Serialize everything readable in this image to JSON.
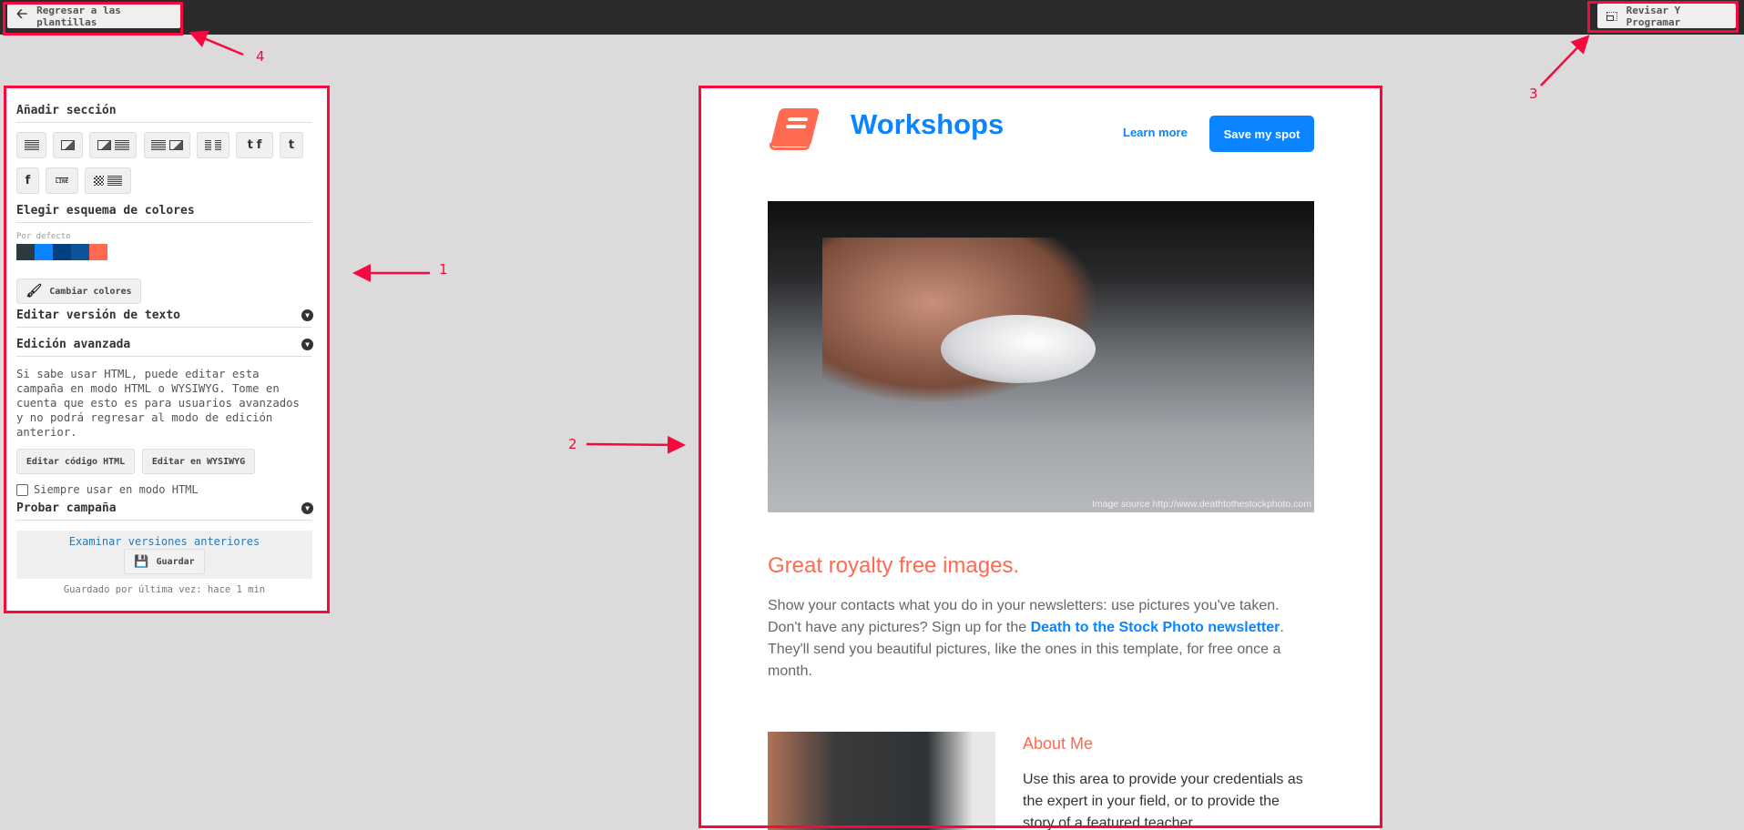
{
  "topbar": {
    "back_label": "Regresar a las plantillas",
    "review_label": "Revisar Y Programar"
  },
  "sidebar": {
    "add_section_title": "Añadir sección",
    "section_blocks": [
      "text",
      "image",
      "image-text",
      "text-image",
      "two-columns",
      "twitter-facebook",
      "twitter",
      "facebook",
      "line",
      "qr-text"
    ],
    "line_label": "LINE",
    "color_scheme_title": "Elegir esquema de colores",
    "scheme_name": "Por defecto",
    "scheme_colors": [
      "#2d3a42",
      "#0a84ff",
      "#02407f",
      "#0b5497",
      "#ff6a50"
    ],
    "change_colors_label": "Cambiar colores",
    "text_version_title": "Editar versión de texto",
    "advanced_title": "Edición avanzada",
    "advanced_text": "Si sabe usar HTML, puede editar esta campaña en modo HTML o WYSIWYG. Tome en cuenta que esto es para usuarios avanzados y no podrá regresar al modo de edición anterior.",
    "edit_html_label": "Editar código HTML",
    "edit_wysiwyg_label": "Editar en WYSIWYG",
    "always_html_label": "Siempre usar en modo HTML",
    "always_html_checked": false,
    "test_title": "Probar campaña",
    "versions_link": "Examinar versiones anteriores",
    "save_label": "Guardar",
    "last_saved": "Guardado por última vez: hace 1 min"
  },
  "email": {
    "brand": "Workshops",
    "learn_more": "Learn more",
    "cta": "Save my spot",
    "image_source": "Image source http://www.deathtothestockphoto.com",
    "heading": "Great royalty free images.",
    "para_1": "Show your contacts what you do in your newsletters: use pictures you've taken. Don't have any pictures? Sign up for the ",
    "para_link": "Death to the Stock Photo newsletter",
    "para_2": ". They'll send you beautiful pictures, like the ones in this template, for free once a month.",
    "about_title": "About Me",
    "about_text": "Use this area to provide your credentials as the expert in your field, or to provide the story of a featured teacher."
  },
  "colors": {
    "accent": "#0a84ff",
    "coral": "#ff6a50",
    "annotation": "#f5093f"
  },
  "annotations": [
    "1",
    "2",
    "3",
    "4"
  ]
}
